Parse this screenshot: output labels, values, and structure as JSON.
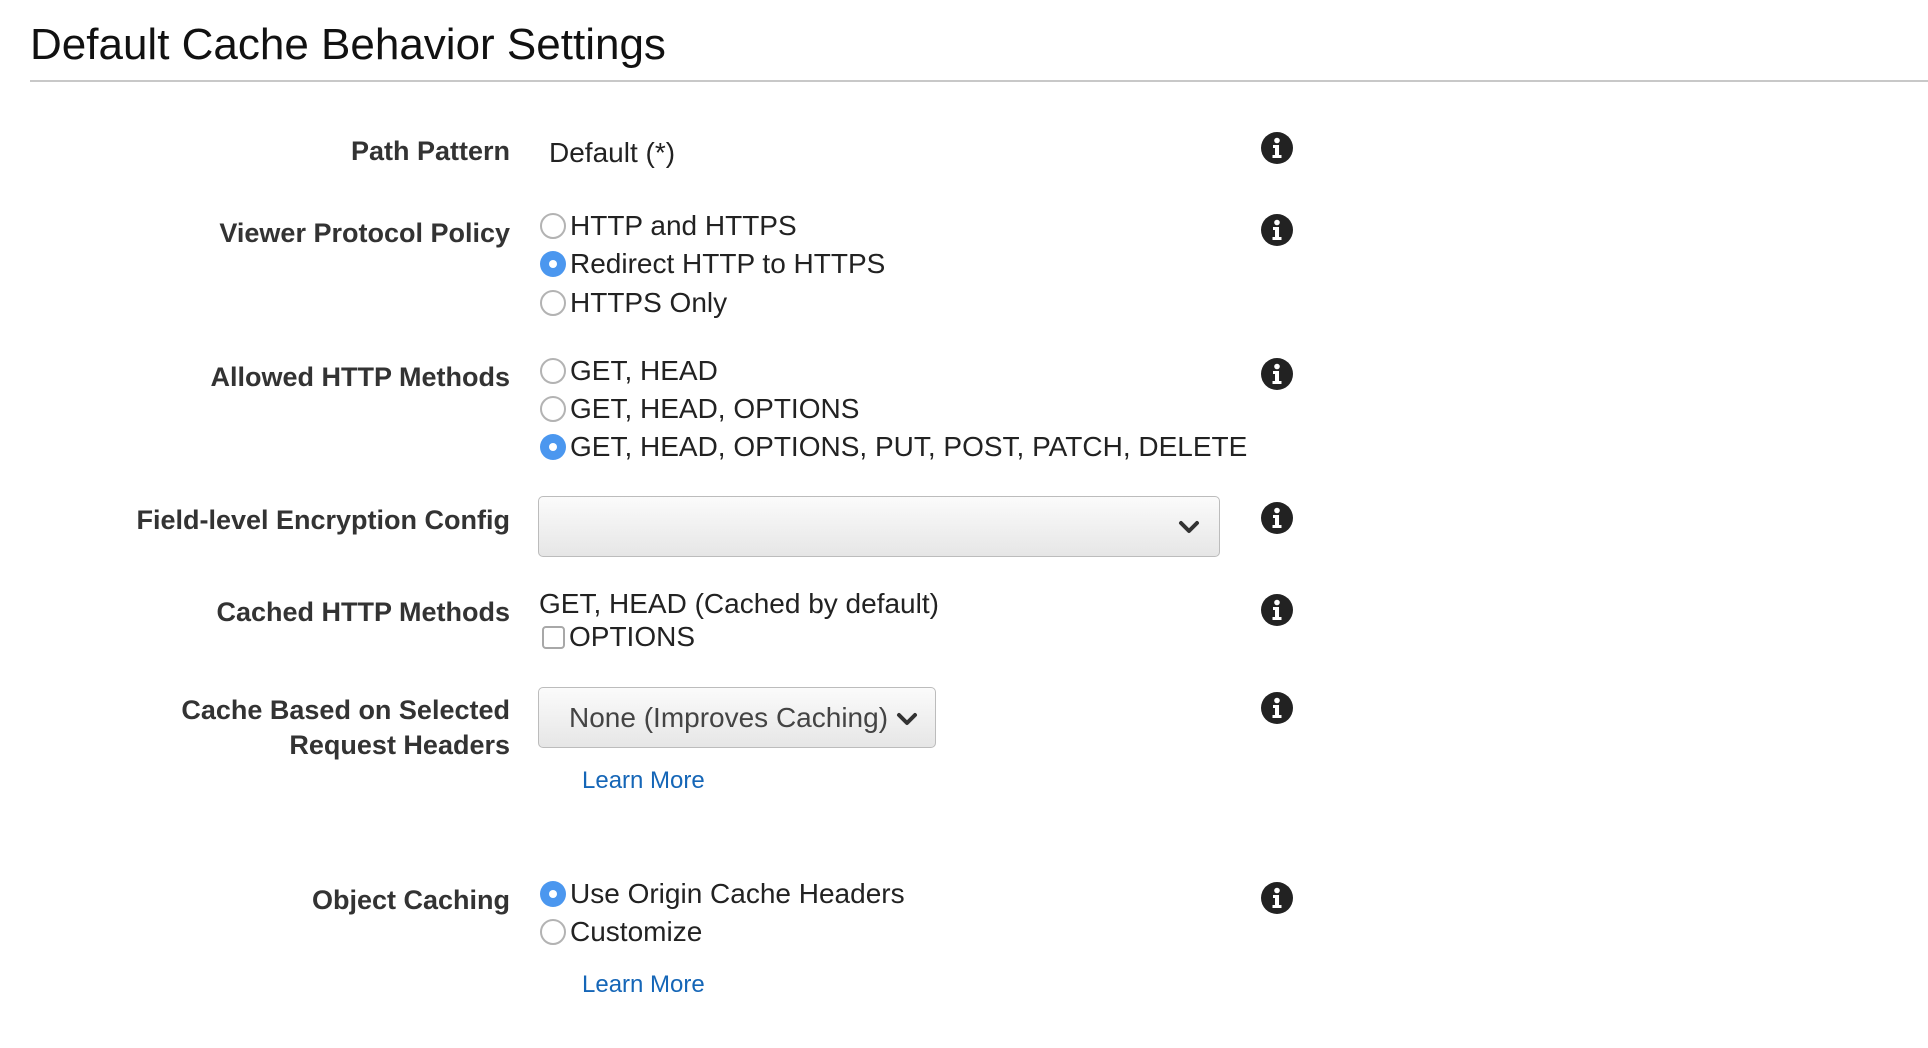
{
  "title": "Default Cache Behavior Settings",
  "path_pattern": {
    "label": "Path Pattern",
    "value": "Default (*)"
  },
  "viewer_protocol_policy": {
    "label": "Viewer Protocol Policy",
    "options": [
      "HTTP and HTTPS",
      "Redirect HTTP to HTTPS",
      "HTTPS Only"
    ],
    "selected": "Redirect HTTP to HTTPS"
  },
  "allowed_http_methods": {
    "label": "Allowed HTTP Methods",
    "options": [
      "GET, HEAD",
      "GET, HEAD, OPTIONS",
      "GET, HEAD, OPTIONS, PUT, POST, PATCH, DELETE"
    ],
    "selected": "GET, HEAD, OPTIONS, PUT, POST, PATCH, DELETE"
  },
  "field_level_encryption": {
    "label": "Field-level Encryption Config",
    "value": ""
  },
  "cached_http_methods": {
    "label": "Cached HTTP Methods",
    "default_text": "GET, HEAD (Cached by default)",
    "options_checkbox_label": "OPTIONS",
    "options_checked": false
  },
  "cache_based_on_headers": {
    "label_line1": "Cache Based on Selected",
    "label_line2": "Request Headers",
    "value": "None (Improves Caching)",
    "learn_more": "Learn More"
  },
  "object_caching": {
    "label": "Object Caching",
    "options": [
      "Use Origin Cache Headers",
      "Customize"
    ],
    "selected": "Use Origin Cache Headers",
    "learn_more": "Learn More"
  },
  "icons": {
    "info": "info-icon",
    "dropdown": "chevron-down-icon"
  },
  "colors": {
    "radio_selected": "#4b97ef",
    "link": "#1566b7",
    "divider": "#c8c8c8"
  }
}
